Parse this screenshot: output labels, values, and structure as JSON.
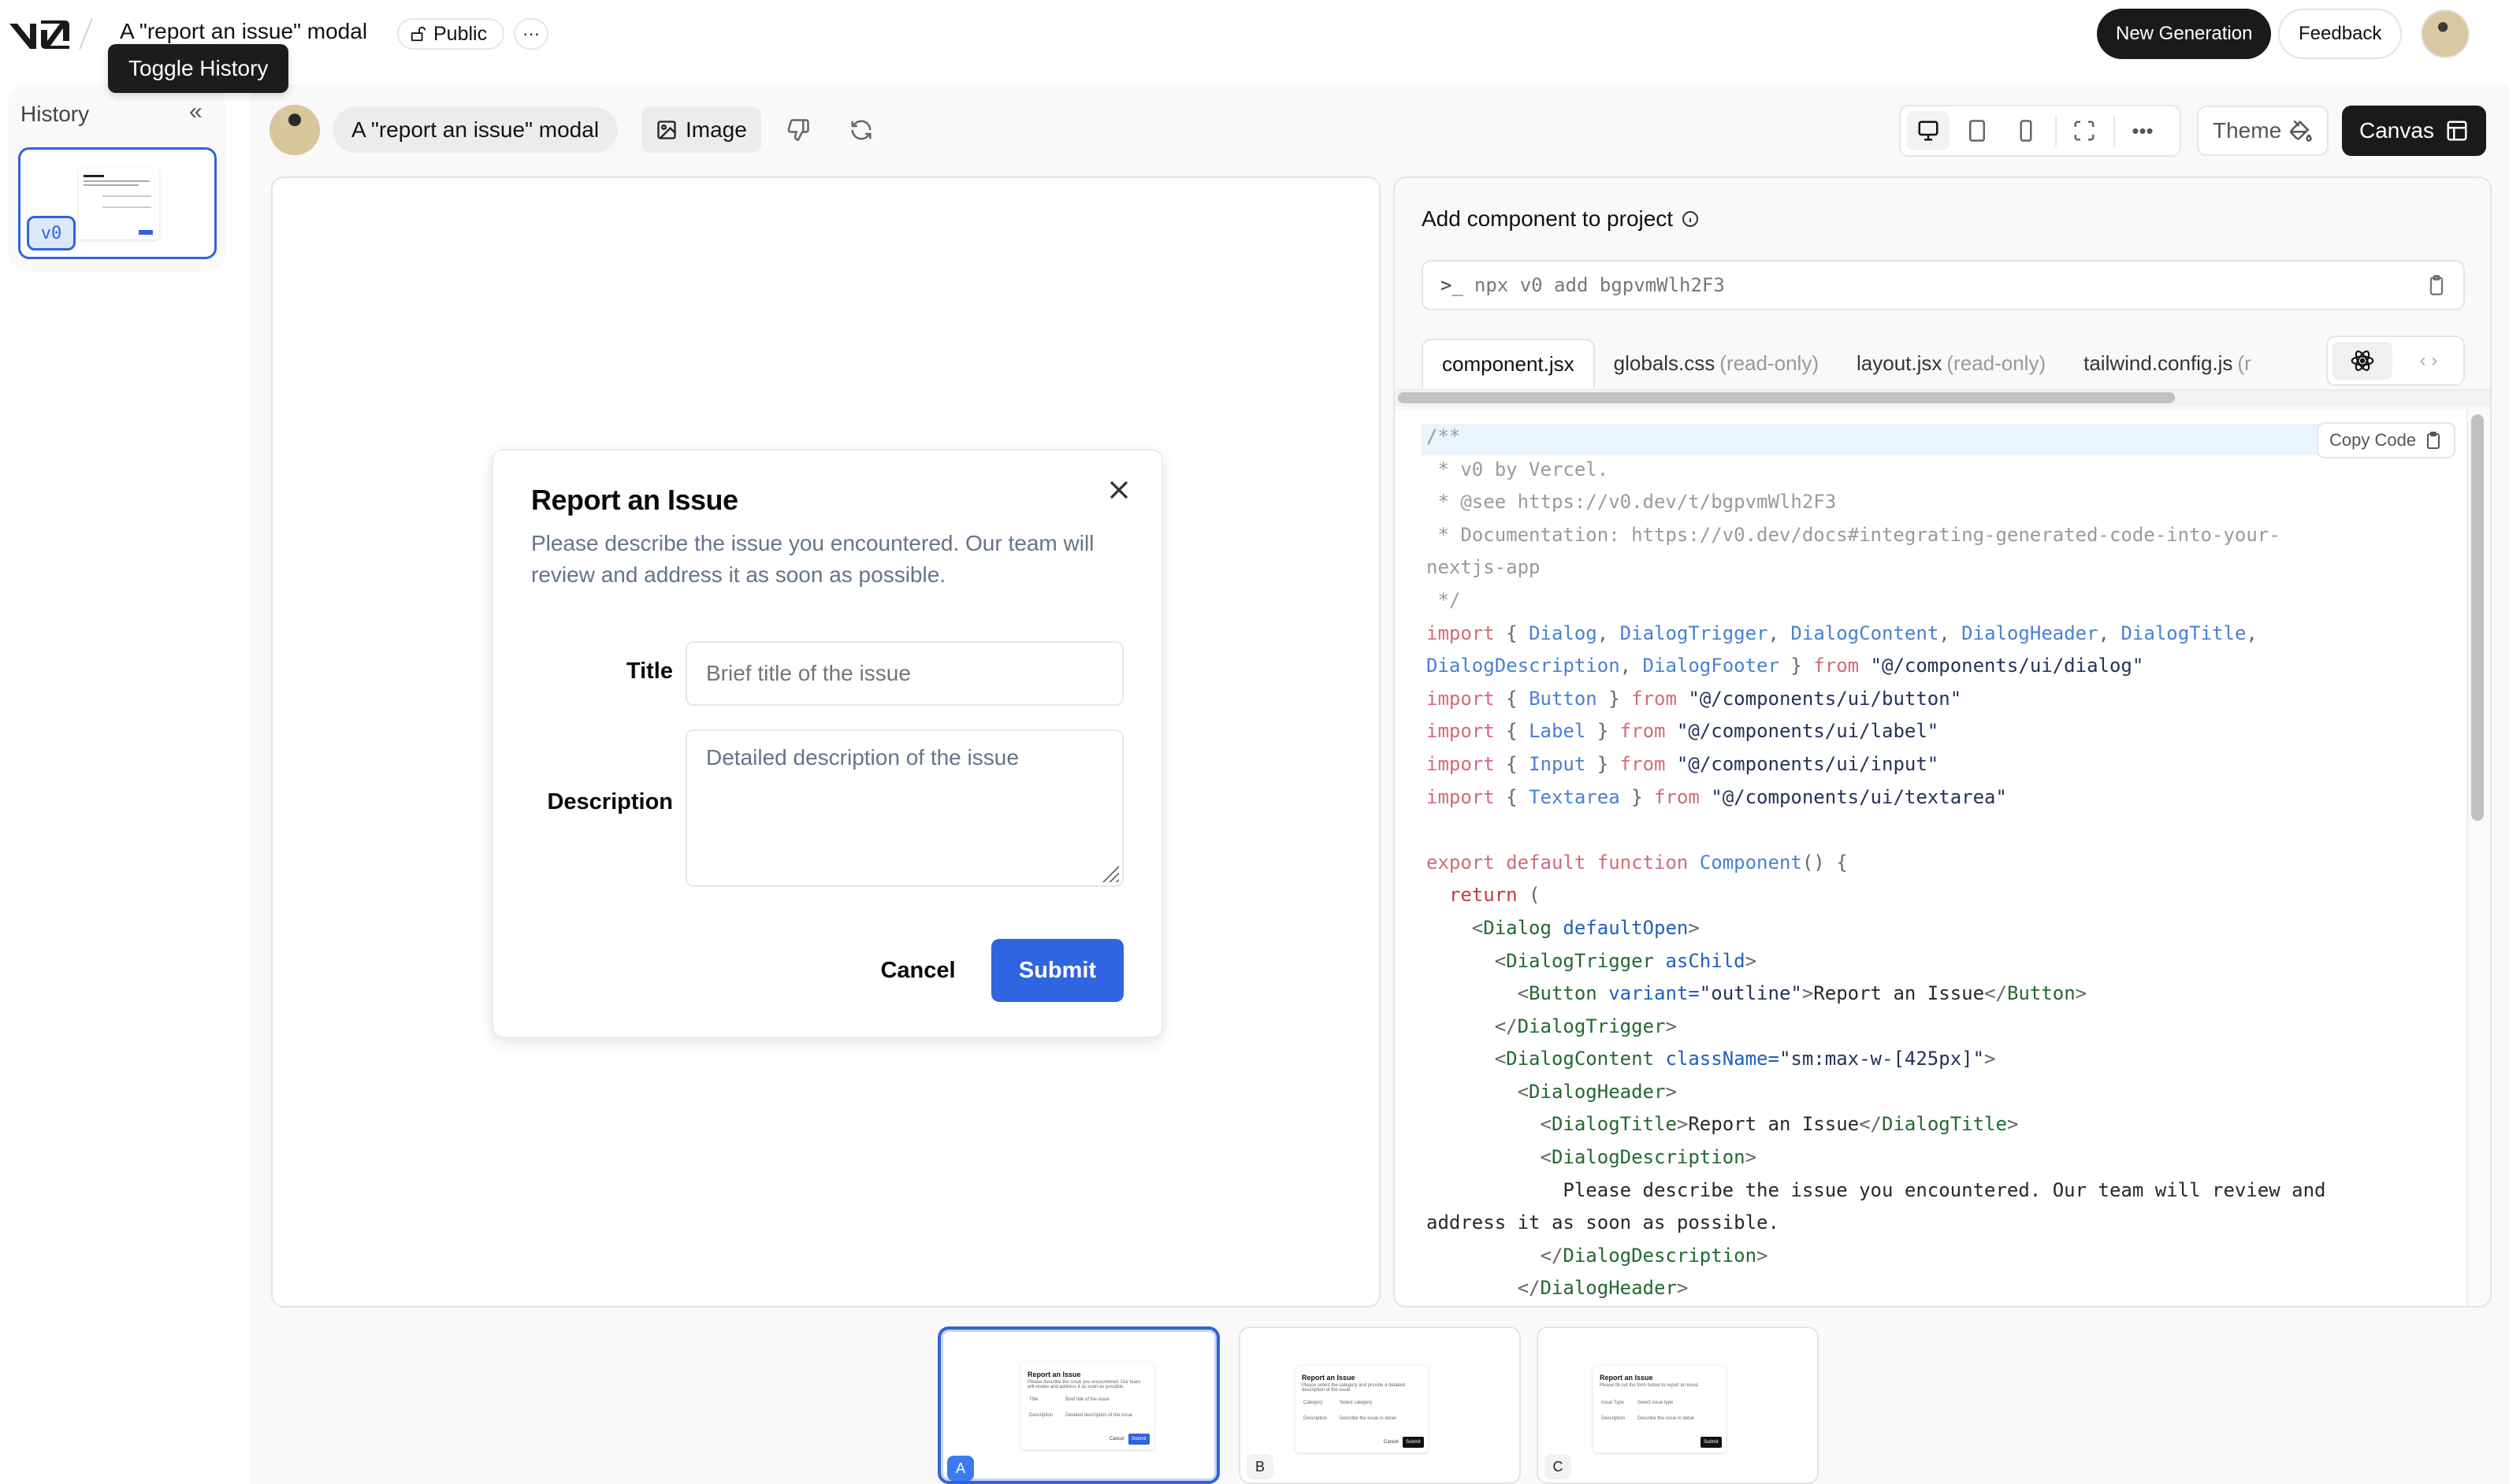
{
  "header": {
    "logo": "v0",
    "project_title": "A \"report an issue\" modal",
    "visibility_label": "Public",
    "more_label": "···",
    "tooltip": "Toggle History",
    "new_generation_label": "New Generation",
    "feedback_label": "Feedback"
  },
  "sidebar": {
    "title": "History",
    "collapse_icon": "chevrons-left-icon",
    "items": [
      {
        "version": "v0",
        "selected": true
      }
    ]
  },
  "toolbar": {
    "prompt": "A \"report an issue\" modal",
    "image_label": "Image",
    "theme_label": "Theme",
    "canvas_label": "Canvas",
    "viewport_icons": [
      "desktop-icon",
      "tablet-icon",
      "mobile-icon",
      "fullscreen-icon",
      "more-icon"
    ],
    "active_viewport": "desktop"
  },
  "modal": {
    "title": "Report an Issue",
    "description": "Please describe the issue you encountered. Our team will review and address it as soon as possible.",
    "title_label": "Title",
    "title_placeholder": "Brief title of the issue",
    "description_label": "Description",
    "description_placeholder": "Detailed description of the issue",
    "cancel_label": "Cancel",
    "submit_label": "Submit",
    "accent": "#3164e0"
  },
  "code_panel": {
    "heading": "Add component to project",
    "cli_prompt": ">_",
    "cli_command": "npx v0 add bgpvmWlh2F3",
    "tabs": [
      {
        "name": "component.jsx",
        "suffix": "",
        "active": true
      },
      {
        "name": "globals.css",
        "suffix": "(read-only)",
        "active": false
      },
      {
        "name": "layout.jsx",
        "suffix": "(read-only)",
        "active": false
      },
      {
        "name": "tailwind.config.js",
        "suffix": "(r",
        "active": false
      }
    ],
    "lang_toggle": [
      "react-icon",
      "code-icon"
    ],
    "copy_code_label": "Copy Code",
    "code_lines": [
      [
        [
          "c-com",
          "/**"
        ]
      ],
      [
        [
          "c-com",
          " * v0 by Vercel."
        ]
      ],
      [
        [
          "c-com",
          " * @see https://v0.dev/t/bgpvmWlh2F3"
        ]
      ],
      [
        [
          "c-com",
          " * Documentation: https://v0.dev/docs#integrating-generated-code-into-your-"
        ]
      ],
      [
        [
          "c-com",
          "nextjs-app"
        ]
      ],
      [
        [
          "c-com",
          " */"
        ]
      ],
      [
        [
          "c-kw",
          "import"
        ],
        [
          "c-punc",
          " { "
        ],
        [
          "c-id",
          "Dialog"
        ],
        [
          "c-punc",
          ", "
        ],
        [
          "c-id",
          "DialogTrigger"
        ],
        [
          "c-punc",
          ", "
        ],
        [
          "c-id",
          "DialogContent"
        ],
        [
          "c-punc",
          ", "
        ],
        [
          "c-id",
          "DialogHeader"
        ],
        [
          "c-punc",
          ", "
        ],
        [
          "c-id",
          "DialogTitle"
        ],
        [
          "c-punc",
          ","
        ]
      ],
      [
        [
          "c-id",
          "DialogDescription"
        ],
        [
          "c-punc",
          ", "
        ],
        [
          "c-id",
          "DialogFooter"
        ],
        [
          "c-punc",
          " } "
        ],
        [
          "c-kw",
          "from"
        ],
        [
          "c-str",
          " \"@/components/ui/dialog\""
        ]
      ],
      [
        [
          "c-kw",
          "import"
        ],
        [
          "c-punc",
          " { "
        ],
        [
          "c-id",
          "Button"
        ],
        [
          "c-punc",
          " } "
        ],
        [
          "c-kw",
          "from"
        ],
        [
          "c-str",
          " \"@/components/ui/button\""
        ]
      ],
      [
        [
          "c-kw",
          "import"
        ],
        [
          "c-punc",
          " { "
        ],
        [
          "c-id",
          "Label"
        ],
        [
          "c-punc",
          " } "
        ],
        [
          "c-kw",
          "from"
        ],
        [
          "c-str",
          " \"@/components/ui/label\""
        ]
      ],
      [
        [
          "c-kw",
          "import"
        ],
        [
          "c-punc",
          " { "
        ],
        [
          "c-id",
          "Input"
        ],
        [
          "c-punc",
          " } "
        ],
        [
          "c-kw",
          "from"
        ],
        [
          "c-str",
          " \"@/components/ui/input\""
        ]
      ],
      [
        [
          "c-kw",
          "import"
        ],
        [
          "c-punc",
          " { "
        ],
        [
          "c-id",
          "Textarea"
        ],
        [
          "c-punc",
          " } "
        ],
        [
          "c-kw",
          "from"
        ],
        [
          "c-str",
          " \"@/components/ui/textarea\""
        ]
      ],
      [
        [
          "c-txt",
          ""
        ]
      ],
      [
        [
          "c-kw",
          "export default function"
        ],
        [
          "c-id",
          " Component"
        ],
        [
          "c-punc",
          "() {"
        ]
      ],
      [
        [
          "c-kw2",
          "  return"
        ],
        [
          "c-punc",
          " ("
        ]
      ],
      [
        [
          "c-punc",
          "    <"
        ],
        [
          "c-tag",
          "Dialog"
        ],
        [
          "c-attr",
          " defaultOpen"
        ],
        [
          "c-punc",
          ">"
        ]
      ],
      [
        [
          "c-punc",
          "      <"
        ],
        [
          "c-tag",
          "DialogTrigger"
        ],
        [
          "c-attr",
          " asChild"
        ],
        [
          "c-punc",
          ">"
        ]
      ],
      [
        [
          "c-punc",
          "        <"
        ],
        [
          "c-tag",
          "Button"
        ],
        [
          "c-attr",
          " variant="
        ],
        [
          "c-str",
          "\"outline\""
        ],
        [
          "c-punc",
          ">"
        ],
        [
          "c-txt",
          "Report an Issue"
        ],
        [
          "c-punc",
          "</"
        ],
        [
          "c-tag",
          "Button"
        ],
        [
          "c-punc",
          ">"
        ]
      ],
      [
        [
          "c-punc",
          "      </"
        ],
        [
          "c-tag",
          "DialogTrigger"
        ],
        [
          "c-punc",
          ">"
        ]
      ],
      [
        [
          "c-punc",
          "      <"
        ],
        [
          "c-tag",
          "DialogContent"
        ],
        [
          "c-attr",
          " className="
        ],
        [
          "c-str",
          "\"sm:max-w-[425px]\""
        ],
        [
          "c-punc",
          ">"
        ]
      ],
      [
        [
          "c-punc",
          "        <"
        ],
        [
          "c-tag",
          "DialogHeader"
        ],
        [
          "c-punc",
          ">"
        ]
      ],
      [
        [
          "c-punc",
          "          <"
        ],
        [
          "c-tag",
          "DialogTitle"
        ],
        [
          "c-punc",
          ">"
        ],
        [
          "c-txt",
          "Report an Issue"
        ],
        [
          "c-punc",
          "</"
        ],
        [
          "c-tag",
          "DialogTitle"
        ],
        [
          "c-punc",
          ">"
        ]
      ],
      [
        [
          "c-punc",
          "          <"
        ],
        [
          "c-tag",
          "DialogDescription"
        ],
        [
          "c-punc",
          ">"
        ]
      ],
      [
        [
          "c-txt",
          "            Please describe the issue you encountered. Our team will review and"
        ]
      ],
      [
        [
          "c-txt",
          "address it as soon as possible."
        ]
      ],
      [
        [
          "c-punc",
          "          </"
        ],
        [
          "c-tag",
          "DialogDescription"
        ],
        [
          "c-punc",
          ">"
        ]
      ],
      [
        [
          "c-punc",
          "        </"
        ],
        [
          "c-tag",
          "DialogHeader"
        ],
        [
          "c-punc",
          ">"
        ]
      ]
    ]
  },
  "variants": [
    {
      "label": "A",
      "selected": true,
      "title": "Report an Issue",
      "desc": "Please describe the issue you encountered. Our team will review and address it as soon as possible.",
      "fields": [
        "Title",
        "Description"
      ],
      "placeholders": [
        "Brief title of the issue",
        "Detailed description of the issue"
      ],
      "buttons": [
        "Cancel",
        "Submit"
      ],
      "button_color": "#3164e0"
    },
    {
      "label": "B",
      "selected": false,
      "title": "Report an Issue",
      "desc": "Please select the category and provide a detailed description of the issue.",
      "fields": [
        "Category",
        "Description"
      ],
      "placeholders": [
        "Select category",
        "Describe the issue in detail"
      ],
      "buttons": [
        "Cancel",
        "Submit"
      ],
      "button_color": "#111111"
    },
    {
      "label": "C",
      "selected": false,
      "title": "Report an Issue",
      "desc": "Please fill out the form below to report an issue.",
      "fields": [
        "Issue Type",
        "Description"
      ],
      "placeholders": [
        "Select issue type",
        "Describe the issue in detail"
      ],
      "buttons": [
        "Submit"
      ],
      "button_color": "#111111"
    }
  ]
}
